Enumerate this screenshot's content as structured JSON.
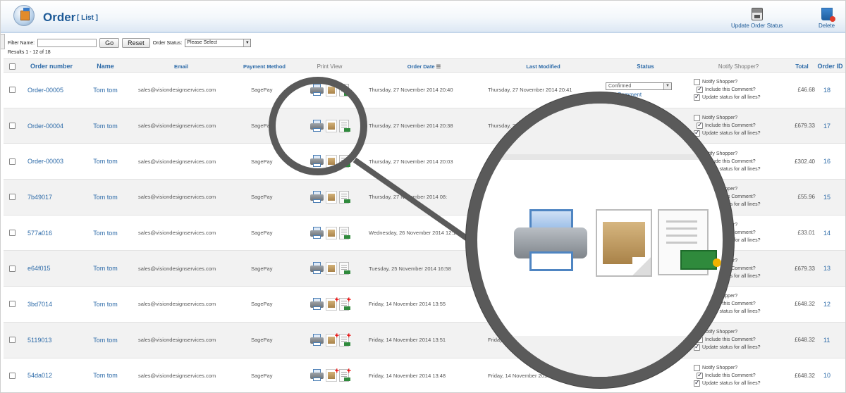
{
  "header": {
    "title": "Order",
    "subtitle": "[ List ]",
    "update_label": "Update Order Status",
    "delete_label": "Delete"
  },
  "filter": {
    "filter_label": "Filter Name:",
    "filter_value": "",
    "go_label": "Go",
    "reset_label": "Reset",
    "status_label": "Order Status:",
    "status_value": "Please Select"
  },
  "results_text": "Results 1 - 12 of 18",
  "columns": {
    "order_number": "Order number",
    "name": "Name",
    "email": "Email",
    "payment": "Payment Method",
    "print": "Print View",
    "order_date": "Order Date",
    "last_modified": "Last Modified",
    "status": "Status",
    "notify": "Notify Shopper?",
    "total": "Total",
    "order_id": "Order ID"
  },
  "notify_labels": {
    "notify": "Notify Shopper?",
    "include": "Include this Comment?",
    "update_all": "Update status for all lines?"
  },
  "status_select": "Confirmed",
  "add_comment": "Add Comment",
  "rows": [
    {
      "num": "Order-00005",
      "name": "Tom tom",
      "email": "sales@visiondesignservices.com",
      "pay": "SagePay",
      "date": "Thursday, 27 November 2014 20:40",
      "modified": "Thursday, 27 November 2014 20:41",
      "total": "£46.68",
      "id": "18"
    },
    {
      "num": "Order-00004",
      "name": "Tom tom",
      "email": "sales@visiondesignservices.com",
      "pay": "SagePay",
      "date": "Thursday, 27 November 2014 20:38",
      "modified": "Thursday, 27 November 2014 20:",
      "total": "£679.33",
      "id": "17"
    },
    {
      "num": "Order-00003",
      "name": "Tom tom",
      "email": "sales@visiondesignservices.com",
      "pay": "SagePay",
      "date": "Thursday, 27 November 2014 20:03",
      "modified": "",
      "total": "£302.40",
      "id": "16"
    },
    {
      "num": "7b49017",
      "name": "Tom tom",
      "email": "sales@visiondesignservices.com",
      "pay": "SagePay",
      "date": "Thursday, 27 November 2014 08:",
      "modified": "",
      "total": "£55.96",
      "id": "15"
    },
    {
      "num": "577a016",
      "name": "Tom tom",
      "email": "sales@visiondesignservices.com",
      "pay": "SagePay",
      "date": "Wednesday, 26 November 2014 12:13",
      "modified": "",
      "total": "£33.01",
      "id": "14"
    },
    {
      "num": "e64f015",
      "name": "Tom tom",
      "email": "sales@visiondesignservices.com",
      "pay": "SagePay",
      "date": "Tuesday, 25 November 2014 16:58",
      "modified": "",
      "total": "£679.33",
      "id": "13"
    },
    {
      "num": "3bd7014",
      "name": "Tom tom",
      "email": "sales@visiondesignservices.com",
      "pay": "SagePay",
      "date": "Friday, 14 November 2014 13:55",
      "modified": "",
      "total": "£648.32",
      "id": "12"
    },
    {
      "num": "5119013",
      "name": "Tom tom",
      "email": "sales@visiondesignservices.com",
      "pay": "SagePay",
      "date": "Friday, 14 November 2014 13:51",
      "modified": "Friday, 14",
      "total": "£648.32",
      "id": "11"
    },
    {
      "num": "54da012",
      "name": "Tom tom",
      "email": "sales@visiondesignservices.com",
      "pay": "SagePay",
      "date": "Friday, 14 November 2014 13:48",
      "modified": "Friday, 14 November 2014 13:48",
      "total": "£648.32",
      "id": "10"
    }
  ]
}
